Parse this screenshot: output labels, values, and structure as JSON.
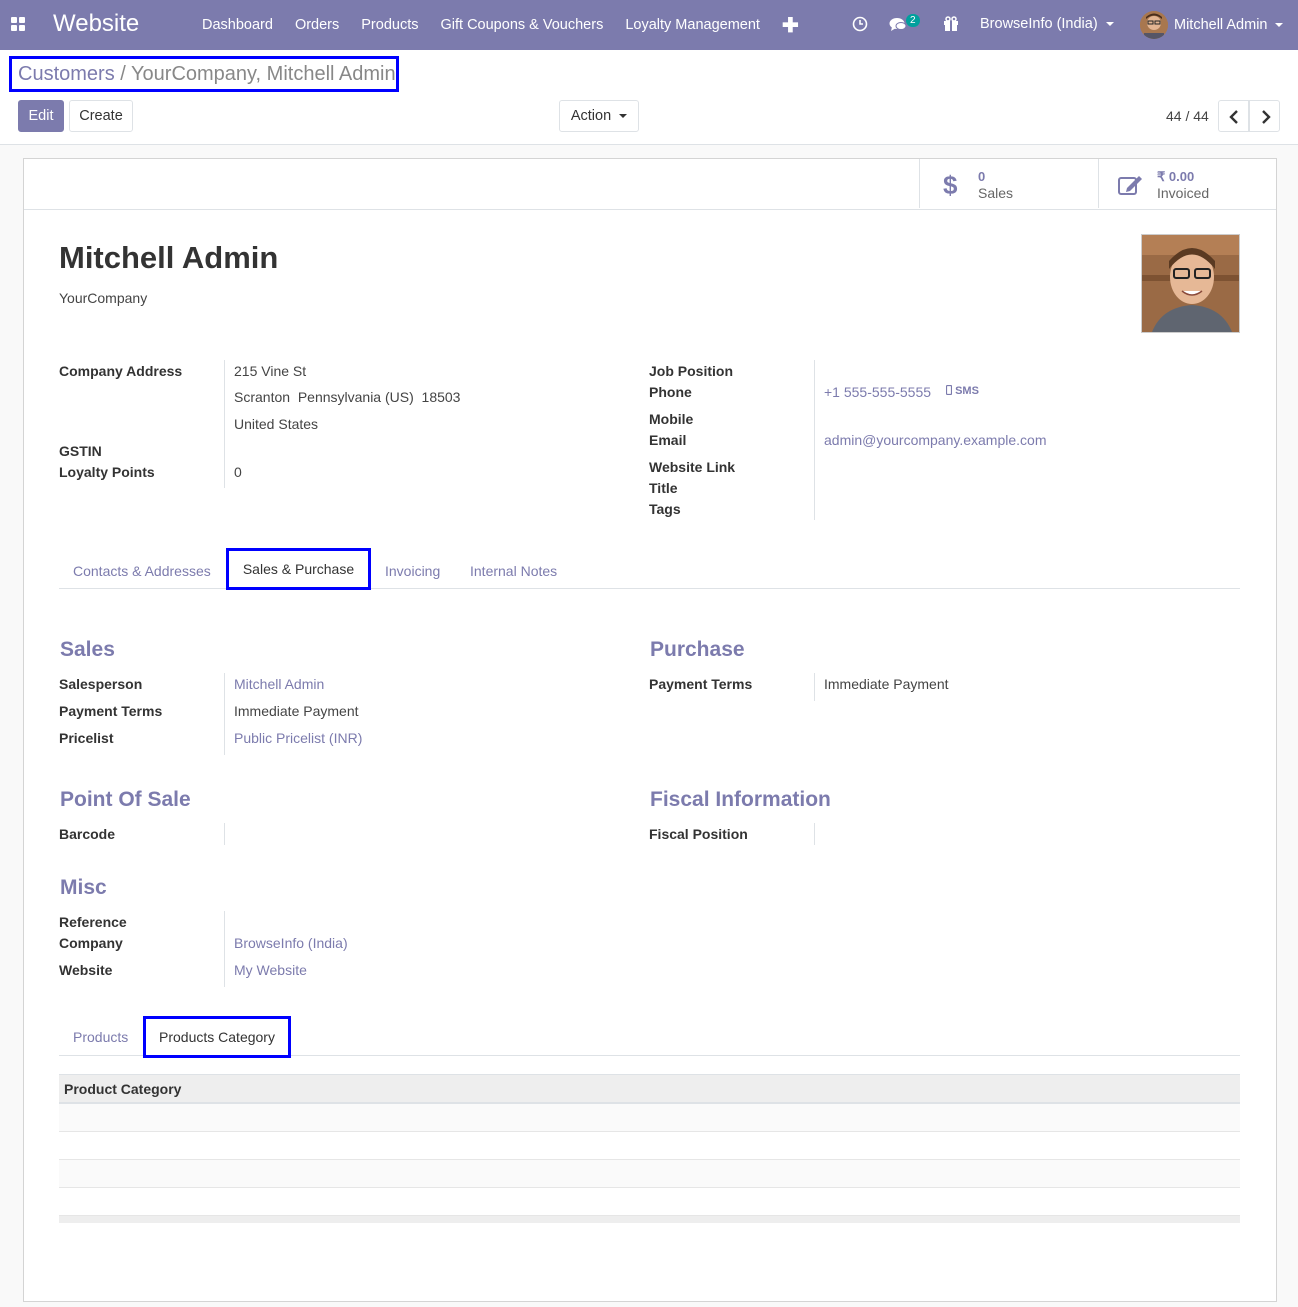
{
  "navbar": {
    "brand": "Website",
    "menu": [
      "Dashboard",
      "Orders",
      "Products",
      "Gift Coupons & Vouchers",
      "Loyalty Management"
    ],
    "plus": "✚",
    "chat_badge": "2",
    "company": "BrowseInfo (India)",
    "user": "Mitchell Admin"
  },
  "breadcrumb": {
    "parent": "Customers",
    "sep": "/",
    "current": "YourCompany, Mitchell Admin"
  },
  "buttons": {
    "edit": "Edit",
    "create": "Create",
    "action": "Action"
  },
  "pager": {
    "value": "44 / 44"
  },
  "stats": {
    "sales": {
      "value": "0",
      "label": "Sales"
    },
    "invoiced": {
      "value": "₹ 0.00",
      "label": "Invoiced"
    }
  },
  "partner": {
    "name": "Mitchell Admin",
    "company": "YourCompany"
  },
  "left_fields": {
    "company_address_label": "Company Address",
    "street": "215 Vine St",
    "city_line": "Scranton  Pennsylvania (US)  18503",
    "country": "United States",
    "gstin_label": "GSTIN",
    "loyalty_label": "Loyalty Points",
    "loyalty_value": "0"
  },
  "right_fields": {
    "job_position": "Job Position",
    "phone_label": "Phone",
    "phone_value": "+1 555-555-5555",
    "sms": "SMS",
    "mobile_label": "Mobile",
    "email_label": "Email",
    "email_value": "admin@yourcompany.example.com",
    "website_link": "Website Link",
    "title": "Title",
    "tags": "Tags"
  },
  "tabs": [
    "Contacts & Addresses",
    "Sales & Purchase",
    "Invoicing",
    "Internal Notes"
  ],
  "sales": {
    "heading": "Sales",
    "salesperson_label": "Salesperson",
    "salesperson_value": "Mitchell Admin",
    "payment_terms_label": "Payment Terms",
    "payment_terms_value": "Immediate Payment",
    "pricelist_label": "Pricelist",
    "pricelist_value": "Public Pricelist (INR)"
  },
  "purchase": {
    "heading": "Purchase",
    "payment_terms_label": "Payment Terms",
    "payment_terms_value": "Immediate Payment"
  },
  "pos": {
    "heading": "Point Of Sale",
    "barcode_label": "Barcode"
  },
  "fiscal": {
    "heading": "Fiscal Information",
    "fiscal_position_label": "Fiscal Position"
  },
  "misc": {
    "heading": "Misc",
    "reference_label": "Reference",
    "company_label": "Company",
    "company_value": "BrowseInfo (India)",
    "website_label": "Website",
    "website_value": "My Website"
  },
  "subtabs": [
    "Products",
    "Products Category"
  ],
  "table": {
    "header": "Product Category"
  },
  "colors": {
    "brand": "#7c7bad",
    "highlight": "#0000ff",
    "badge": "#00a09d"
  }
}
